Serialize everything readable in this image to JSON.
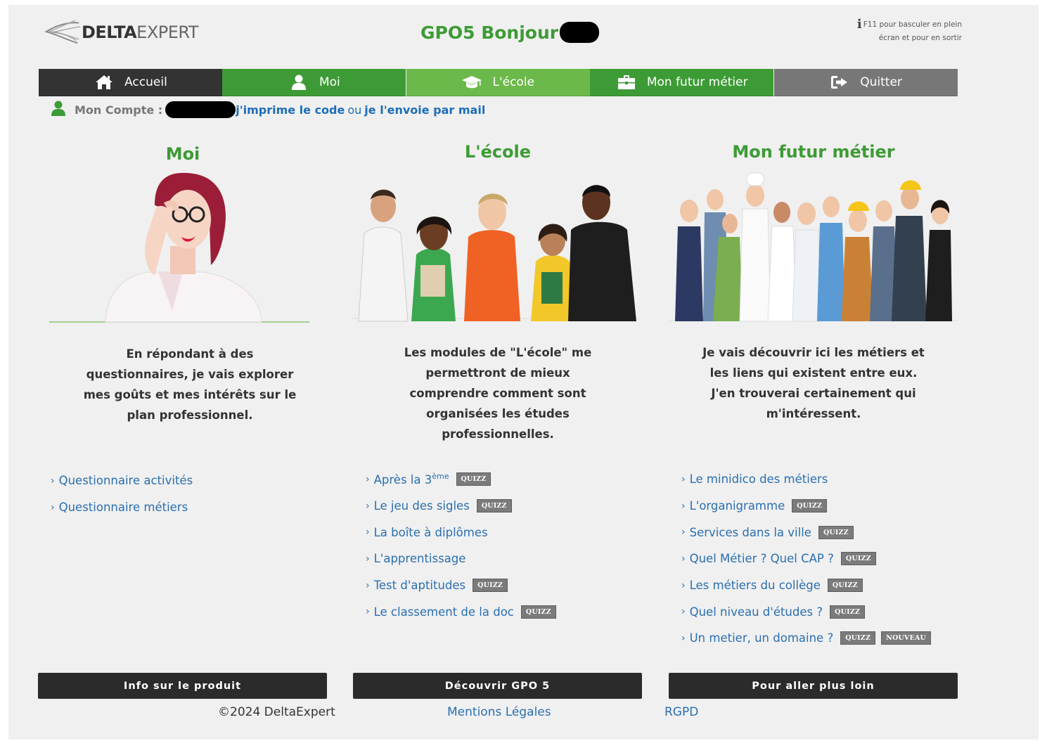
{
  "header": {
    "logo_bold": "DELTA",
    "logo_light": "EXPERT",
    "greeting": "GPO5 Bonjour",
    "fullscreen_note_1": "F11 pour basculer en plein",
    "fullscreen_note_2": "écran et pour en sortir"
  },
  "nav": {
    "tabs": [
      {
        "label": "Accueil",
        "icon": "home-icon",
        "color": "#333333"
      },
      {
        "label": "Moi",
        "icon": "user-icon",
        "color": "#3d9b35"
      },
      {
        "label": "L'école",
        "icon": "graduation-cap-icon",
        "color": "#6cb94b"
      },
      {
        "label": "Mon futur métier",
        "icon": "briefcase-icon",
        "color": "#3d9b35"
      },
      {
        "label": "Quitter",
        "icon": "sign-out-icon",
        "color": "#777777"
      }
    ]
  },
  "account": {
    "label": "Mon Compte :",
    "print_link": "j'imprime le code",
    "or": "ou",
    "mail_link": "je l'envoie par mail"
  },
  "columns": [
    {
      "title": "Moi",
      "image": "woman-with-glasses-photo",
      "text_lines": [
        "En répondant à des",
        "questionnaires, je vais explorer",
        "mes goûts et mes intérêts sur le",
        "plan professionnel."
      ],
      "links": [
        {
          "label": "Questionnaire activités"
        },
        {
          "label": "Questionnaire métiers"
        }
      ]
    },
    {
      "title": "L'école",
      "image": "group-of-students-photo",
      "text_lines": [
        "Les modules de \"L'école\" me",
        "permettront de mieux",
        "comprendre comment sont",
        "organisées les études",
        "professionnelles."
      ],
      "links": [
        {
          "label": "Après la 3",
          "sup": "ème",
          "badges": [
            "QUIZZ"
          ]
        },
        {
          "label": "Le jeu des sigles",
          "badges": [
            "QUIZZ"
          ]
        },
        {
          "label": "La boîte à diplômes"
        },
        {
          "label": "L'apprentissage"
        },
        {
          "label": "Test d'aptitudes",
          "badges": [
            "QUIZZ"
          ]
        },
        {
          "label": "Le classement de la doc",
          "badges": [
            "QUIZZ"
          ]
        }
      ]
    },
    {
      "title": "Mon futur métier",
      "image": "group-of-workers-photo",
      "text_lines": [
        "Je vais découvrir ici les métiers et",
        "les liens qui existent entre eux.",
        "J'en trouverai certainement qui",
        "m'intéressent."
      ],
      "links": [
        {
          "label": "Le minidico des métiers"
        },
        {
          "label": "L'organigramme",
          "badges": [
            "QUIZZ"
          ]
        },
        {
          "label": "Services dans la ville",
          "badges": [
            "QUIZZ"
          ]
        },
        {
          "label": "Quel Métier ? Quel CAP ?",
          "badges": [
            "QUIZZ"
          ]
        },
        {
          "label": "Les métiers du collège",
          "badges": [
            "QUIZZ"
          ]
        },
        {
          "label": "Quel niveau d'études ?",
          "badges": [
            "QUIZZ"
          ]
        },
        {
          "label": "Un metier, un domaine ?",
          "badges": [
            "QUIZZ",
            "NOUVEAU"
          ]
        }
      ]
    }
  ],
  "footer": {
    "buttons": [
      "Info sur le produit",
      "Découvrir GPO 5",
      "Pour aller plus loin"
    ],
    "copyright": "©2024 DeltaExpert",
    "mentions": "Mentions Légales",
    "rgpd": "RGPD"
  }
}
